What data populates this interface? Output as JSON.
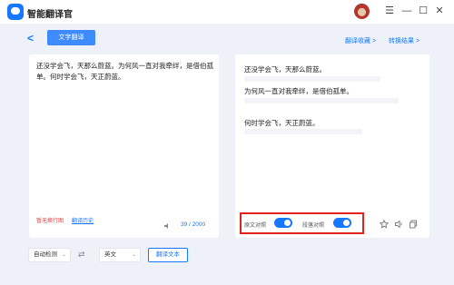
{
  "app": {
    "title": "智能翻译官"
  },
  "window": {
    "menu_icon": "☰",
    "minimize_icon": "—",
    "maximize_icon": "☐",
    "close_icon": "✕"
  },
  "toolbar": {
    "back_icon": "<",
    "mode": "文字翻译",
    "history_link": "翻译收藏 >",
    "switch_link": "转换结果 >"
  },
  "source": {
    "text": "还没学会飞，天那么蔚蓝。为何风一直对我牵绊，是借伯孤单。何时学会飞，天正蔚蓝。",
    "warning": "暂无换行图",
    "warning_link": "翻译历史",
    "char_count": "39 / 2000"
  },
  "result": {
    "lines": [
      "还没学会飞，天那么蔚蓝。",
      "为何风一直对我牵绊，是借伯孤单。",
      "何时学会飞，天正蔚蓝。"
    ],
    "toggle1_label": "原文对照",
    "toggle2_label": "段落对照",
    "toggle1_on": true,
    "toggle2_on": true
  },
  "controls": {
    "from_lang": "自动检测",
    "to_lang": "英文",
    "translate_button": "翻译文本"
  },
  "colors": {
    "accent": "#1677ff",
    "highlight": "#e3231b",
    "background": "#eef2f8"
  }
}
